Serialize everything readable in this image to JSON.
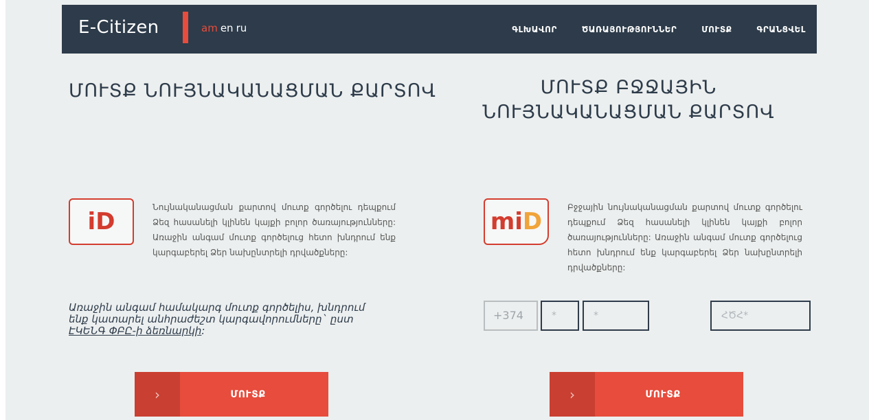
{
  "header": {
    "logo": "E-Citizen",
    "languages": [
      {
        "label": "am",
        "active": true
      },
      {
        "label": "en",
        "active": false
      },
      {
        "label": "ru",
        "active": false
      }
    ],
    "nav": [
      "ԳԼԽԱՎՈՐ",
      "ԾԱՌԱՅՈՒԹՅՈՒՆՆԵՐ",
      "ՄՈՒՏՔ",
      "ԳՐԱՆՑՎԵԼ"
    ]
  },
  "left": {
    "title": "ՄՈՒՏՔ ՆՈՒՅՆԱԿԱՆԱՑՄԱՆ ՔԱՐՏՈՎ",
    "icon_text": "iD",
    "description": "Նույնականացման քարտով մուտք գործելու դեպքում Ձեզ հասանելի կլինեն կայքի բոլոր ծառայությունները: Առաջին անգամ մուտք գործելուց հետո խնդրում ենք կարգաբերել Ձեր նախընտրելի դրվածքները:",
    "notice_text": "Առաջին անգամ համակարգ մուտք գործելիս, խնդրում ենք կատարել անհրաժեշտ կարգավորումները` ըստ ",
    "notice_link": "ԷԿԵՆԳ ՓԲԸ-ի ձեռնարկի",
    "notice_end": ":",
    "button_label": "ՄՈՒՏՔ",
    "button_arrow": "›"
  },
  "right": {
    "title_line1": "ՄՈՒՏՔ ԲՋՋԱՅԻՆ",
    "title_line2": "ՆՈՒՅՆԱԿԱՆԱՑՄԱՆ ՔԱՐՏՈՎ",
    "icon_text_m": "m",
    "icon_text_i": "i",
    "icon_text_d": "D",
    "description": "Բջջային նույնականացման քարտով մուտք գործելու դեպքում Ձեզ հասանելի կլինեն կայքի բոլոր ծառայությունները: Առաջին անգամ մուտք գործելուց հետո խնդրում ենք կարգաբերել Ձեր նախընտրելի դրվածքները:",
    "phone_code": "+374",
    "field_a_placeholder": "*",
    "field_b_placeholder": "*",
    "pin_placeholder": "ՀԾՀ*",
    "button_label": "ՄՈՒՏՔ",
    "button_arrow": "›"
  },
  "colors": {
    "header_bg": "#2d3b4a",
    "accent": "#e74c3c",
    "page_bg": "#ecefef"
  }
}
